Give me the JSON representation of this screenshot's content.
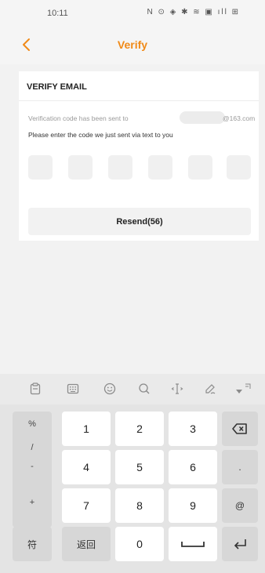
{
  "status_bar": {
    "time": "10:11",
    "icons_text": "N ⊙ ◈ ✱ ≋ ▣ ıll ⊞"
  },
  "header": {
    "title": "Verify"
  },
  "verify_card": {
    "title": "VERIFY EMAIL",
    "sent_message": "Verification code has been sent to",
    "email_domain": "@163.com",
    "instructions": "Please enter the code we just sent via text to you",
    "code_boxes": 6,
    "resend_label": "Resend(56)"
  },
  "keyboard": {
    "toolbar_icons": [
      "clipboard-icon",
      "keyboard-icon",
      "emoji-icon",
      "search-icon",
      "cursor-icon",
      "handwriting-icon",
      "collapse-icon"
    ],
    "symbols": [
      "%",
      "/",
      "-",
      "+"
    ],
    "digit_rows": [
      [
        "1",
        "2",
        "3"
      ],
      [
        "4",
        "5",
        "6"
      ],
      [
        "7",
        "8",
        "9"
      ]
    ],
    "right_keys": [
      ".",
      "@"
    ],
    "bottom": {
      "fu": "符",
      "fanhui": "返回",
      "zero": "0"
    }
  },
  "colors": {
    "accent": "#f08a18",
    "page_bg": "#f2f2f2",
    "card_bg": "#ffffff",
    "keyboard_bg": "#e4e4e4"
  }
}
